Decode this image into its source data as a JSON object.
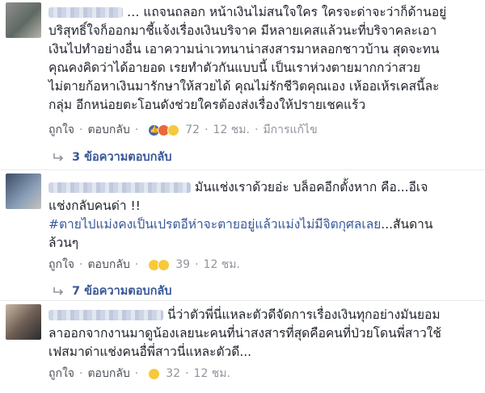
{
  "comments": [
    {
      "name_suffix": "…",
      "lines": [
        "แถจนถลอก หน้าเงินไม่สนใจใคร ใครจะด่าจะว่าก็ด้านอยู่",
        "บริสุทธิ์ใจก็ออกมาชี้แจ้งเรื่องเงินบริจาค มีหลายเคสแล้วนะที่บริจาคละเอา",
        "เงินไปทำอย่างอื่น เอาความน่าเวทนาน่าสงสารมาหลอกชาวบ้าน สุดจะทน",
        "คุณคงคิดว่าได้อายอด เรยทำตัวกันแบบนี้ เป็นเราห่วงตายมากกว่าสวย",
        "ไม่ตายก้อหาเงินมารักษาให้สวยได้ คุณไม่รักชีวิตคุณเอง เห้ออเห้รเคสนี้ละ",
        "กลุ่ม อีกหน่อยตะโอนดังช่วยใครต้องส่งเรื่องให้ปรายเชคแร้ว"
      ],
      "like_label": "ถูกใจ",
      "reply_label": "ตอบกลับ",
      "reaction_count": "72",
      "time": "12 ชม.",
      "edited": "มีการแก้ไข",
      "replies_label": "3 ข้อความตอบกลับ"
    },
    {
      "lines": [
        "มันแช่งเราด้วยอ่ะ บล็อคอีกตั้งหาก คือ...อีเจ",
        "แช่งกลับคนด่า !!"
      ],
      "hashtag_lines": [
        "#ตายไปแม่งคงเป็นเปรตอีห่าจะตายอยู่แล้วแม่งไม่มีจิตกุศลเลย",
        "ล้วนๆ"
      ],
      "hashtag_tail": "...สันดาน",
      "like_label": "ถูกใจ",
      "reply_label": "ตอบกลับ",
      "reaction_count": "39",
      "time": "12 ชม.",
      "replies_label": "7 ข้อความตอบกลับ"
    },
    {
      "lines": [
        "นี่ว่าตัวพี่นี่แหละตัวดีจัดการเรื่องเงินทุกอย่างมันยอม",
        "ลาออกจากงานมาดูน้องเลยนะคนที่น่าสงสารที่สุดคือคนที่ป่วยโดนพี่สาวใช้",
        "เฟสมาด่าแช่งคนอื่พี่สาวนี่แหละตัวดี..."
      ],
      "like_label": "ถูกใจ",
      "reply_label": "ตอบกลับ",
      "reaction_count": "32",
      "time": "12 ชม."
    }
  ],
  "colors": {
    "link": "#365899",
    "meta": "#90949c",
    "text": "#1d2129"
  }
}
